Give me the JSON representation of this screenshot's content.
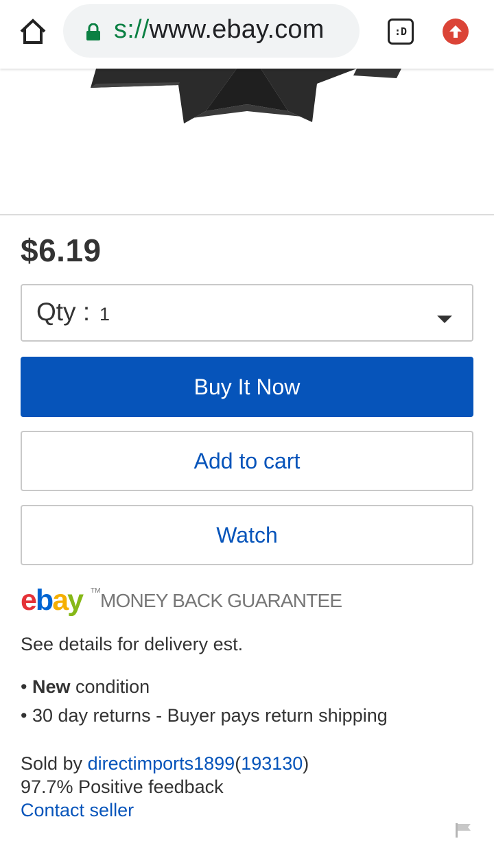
{
  "browser": {
    "url_scheme_partial": "s://",
    "url_host": "www.ebay.com",
    "tab_switcher_label": ":D"
  },
  "product": {
    "price": "$6.19",
    "quantity": {
      "label": "Qty :",
      "selected_value": "1"
    },
    "buttons": {
      "buy_now": "Buy It Now",
      "add_to_cart": "Add to cart",
      "watch": "Watch"
    },
    "guarantee": {
      "logo_letters": [
        "e",
        "b",
        "a",
        "y"
      ],
      "logo_tm": "TM",
      "text": "MONEY BACK GUARANTEE"
    },
    "delivery_text": "See details for delivery est.",
    "condition": {
      "bullet": "•",
      "value": "New",
      "suffix": "condition"
    },
    "returns": {
      "bullet": "•",
      "text": "30 day returns - Buyer pays return shipping"
    }
  },
  "seller": {
    "sold_by_label": "Sold by",
    "username": "directimports1899",
    "open_paren": "(",
    "feedback_score": "193130",
    "close_paren": ")",
    "positive_feedback": "97.7% Positive feedback",
    "contact_label": "Contact seller"
  },
  "colors": {
    "accent_blue": "#0654ba",
    "ebay_red": "#e53238",
    "ebay_blue": "#0064d2",
    "ebay_yellow": "#f5af02",
    "ebay_green": "#86b817",
    "lock_green": "#0b8043",
    "update_red": "#db4437"
  },
  "icons": [
    "home-icon",
    "lock-icon",
    "tab-switcher-icon",
    "update-icon",
    "chevron-down-icon",
    "flag-icon"
  ]
}
